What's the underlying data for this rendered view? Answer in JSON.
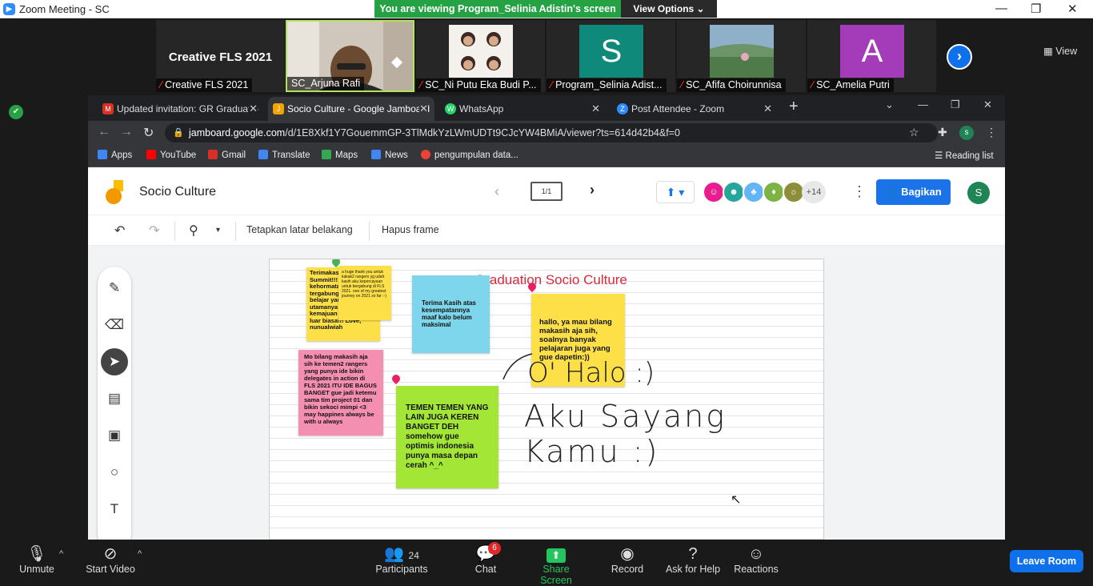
{
  "window": {
    "title": "Zoom Meeting - SC",
    "logo_glyph": "▶"
  },
  "banner": {
    "viewing": "You are viewing Program_Selinia Adistin's screen",
    "view_options": "View Options ⌄"
  },
  "window_controls": {
    "minimize": "—",
    "restore": "❐",
    "close": "✕"
  },
  "participants_strip": {
    "tiles": [
      {
        "name": "Creative FLS 2021",
        "big_label": "Creative FLS 2021",
        "type": "text"
      },
      {
        "name": "SC_Arjuna Rafi",
        "type": "video",
        "active": true
      },
      {
        "name": "SC_Ni Putu Eka Budi P...",
        "type": "photo"
      },
      {
        "name": "Program_Selinia Adist...",
        "avatar_letter": "S",
        "avatar_color": "#0f8a7a",
        "type": "avatar"
      },
      {
        "name": "SC_Afifa Choirunnisa",
        "type": "photo"
      },
      {
        "name": "SC_Amelia Putri",
        "avatar_letter": "A",
        "avatar_color": "#a43bb8",
        "type": "avatar"
      }
    ],
    "mic_muted_glyph": "⁄",
    "next_glyph": "›",
    "view_label": "View"
  },
  "browser": {
    "tabs": [
      {
        "title": "Updated invitation: GR Graduatio",
        "icon": "gmail-icon",
        "icon_color": "#d93025",
        "icon_glyph": "M"
      },
      {
        "title": "Socio Culture - Google Jamboard",
        "icon": "jamboard-icon",
        "icon_color": "#f4a300",
        "icon_glyph": "J",
        "active": true
      },
      {
        "title": "WhatsApp",
        "icon": "whatsapp-icon",
        "icon_color": "#25d366",
        "icon_glyph": "W"
      },
      {
        "title": "Post Attendee - Zoom",
        "icon": "zoom-icon",
        "icon_color": "#2D8CFF",
        "icon_glyph": "Z"
      }
    ],
    "tab_close": "✕",
    "new_tab": "+",
    "url_host": "jamboard.google.com",
    "url_path": "/d/1E8Xkf1Y7GouemmGP-3TlMdkYzLWmUDTt9CJcYW4BMiA/viewer?ts=614d42b4&f=0",
    "account_initial": "s",
    "bookmarks": [
      {
        "label": "Apps",
        "icon": "apps-icon",
        "color": "#4285f4"
      },
      {
        "label": "YouTube",
        "icon": "youtube-icon",
        "color": "#ff0000"
      },
      {
        "label": "Gmail",
        "icon": "gmail-icon",
        "color": "#d93025"
      },
      {
        "label": "Translate",
        "icon": "translate-icon",
        "color": "#4285f4"
      },
      {
        "label": "Maps",
        "icon": "maps-icon",
        "color": "#34a853"
      },
      {
        "label": "News",
        "icon": "news-icon",
        "color": "#4285f4"
      },
      {
        "label": "pengumpulan data...",
        "icon": "google-icon",
        "color": "#ea4335"
      }
    ],
    "reading_list": "Reading list"
  },
  "jamboard": {
    "title": "Socio Culture",
    "frame_counter": "1/1",
    "prev_glyph": "‹",
    "next_glyph": "›",
    "present_glyph": "⬆ ▾",
    "collaborators": [
      {
        "color": "#e91e8c",
        "glyph": "☺"
      },
      {
        "color": "#26a69a",
        "glyph": "☻"
      },
      {
        "color": "#64b5f6",
        "glyph": "♣"
      },
      {
        "color": "#7cb342",
        "glyph": "♦"
      },
      {
        "color": "#8d8d3a",
        "glyph": "☼"
      }
    ],
    "more_collaborators": "+14",
    "kebab": "⋮",
    "share_label": "Bagikan",
    "user_initial": "S",
    "toolbar": {
      "undo": "↶",
      "redo": "↷",
      "zoom": "⚲",
      "zoom_caret": "▾",
      "set_background": "Tetapkan latar belakang",
      "clear_frame": "Hapus frame"
    },
    "left_tools": [
      "✎",
      "⌫",
      "➤",
      "▤",
      "▣",
      "○",
      "T"
    ],
    "board_title": "Graduation Socio Culture",
    "notes": [
      {
        "text": "Terimakasih FLS Summit!!! suatu kehormatan bisa tergabung banyak belajar yang saya utamanya bekerja kemajuan digital FLS luar biasa!!! Love, nunualwiah",
        "color": "#fde047"
      },
      {
        "text": "a huge thank you untuk kakak2 rangers yg udah kasih aku kepercayaan untuk bergabung di FLS 2021. one of my greatest journey on 2021 so far :-)",
        "color": "#fde047"
      },
      {
        "text": "Terima Kasih atas kesempatannya maaf kalo belum maksimal",
        "color": "#7dd6eb"
      },
      {
        "text": "hallo, ya mau bilang makasih aja sih, soalnya banyak pelajaran juga yang gue dapetin:))",
        "color": "#fde047"
      },
      {
        "text": "Mo bilang makasih aja sih ke temen2 rangers yang punya ide bikin delegates in action di FLS 2021 ITU IDE BAGUS BANGET gue jadi ketemu sama tim project 01 dan bikin sekoci mimpi <3 may happines always be with u always",
        "color": "#f48fb1"
      },
      {
        "text": "TEMEN TEMEN YANG LAIN JUGA KEREN BANGET DEH somehow gue optimis indonesia punya masa depan cerah ^_^",
        "color": "#a3e635"
      }
    ],
    "handwriting": [
      "O' Halo :)",
      "Aku Sayang Kamu :)"
    ]
  },
  "controls": {
    "unmute": "Unmute",
    "start_video": "Start Video",
    "participants": "Participants",
    "participants_count": "24",
    "chat": "Chat",
    "chat_badge": "6",
    "share_screen": "Share Screen",
    "record": "Record",
    "ask_for_help": "Ask for Help",
    "reactions": "Reactions",
    "leave_room": "Leave Room"
  }
}
